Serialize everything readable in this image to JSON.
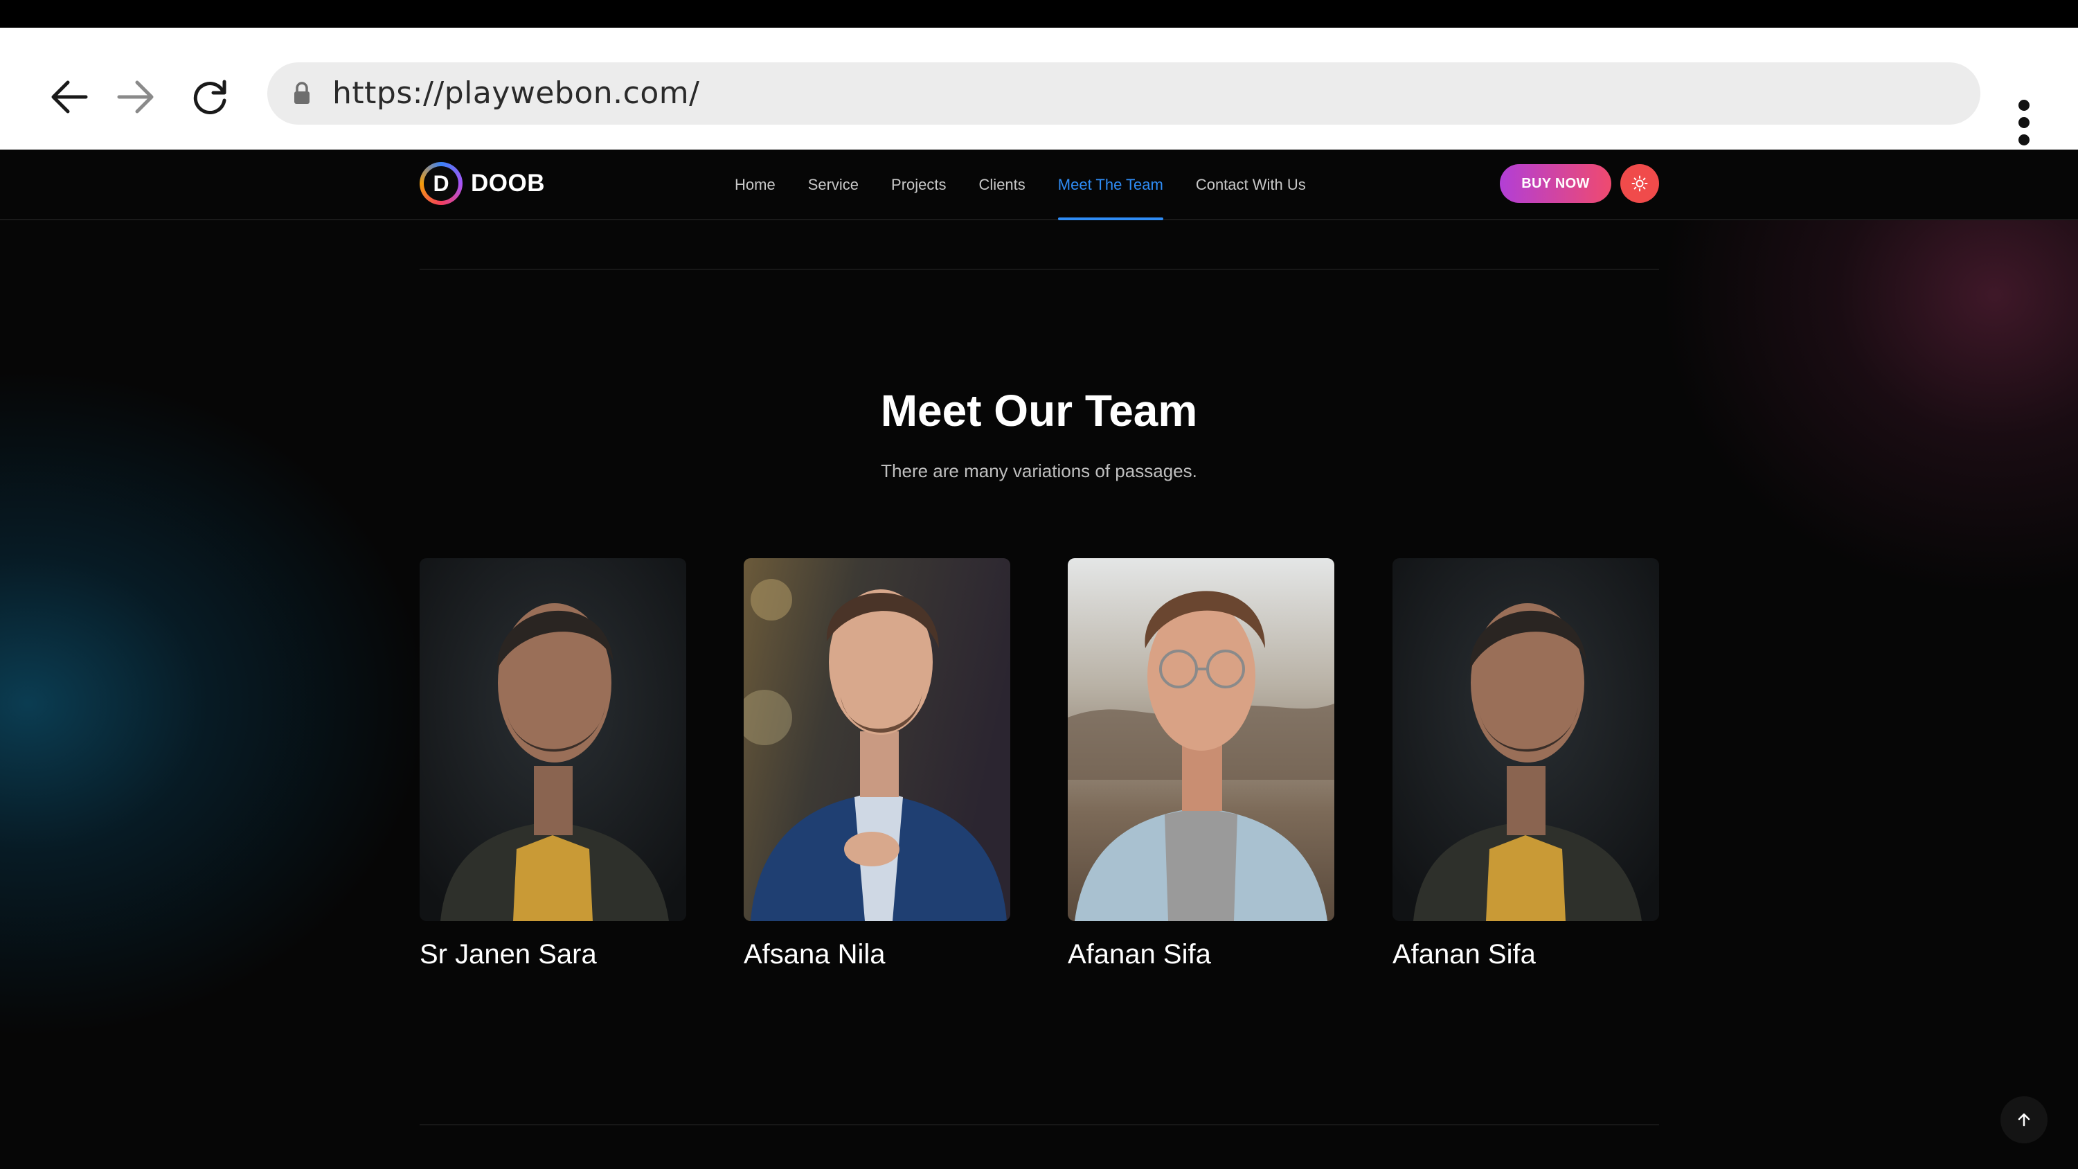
{
  "browser": {
    "url": "https://playwebon.com/",
    "back_icon": "arrow-left-icon",
    "forward_icon": "arrow-right-icon",
    "reload_icon": "reload-icon",
    "lock_icon": "lock-icon",
    "menu_icon": "more-vertical-icon"
  },
  "site": {
    "logo_letter": "D",
    "logo_text": "DOOB",
    "nav": [
      {
        "label": "Home",
        "active": false
      },
      {
        "label": "Service",
        "active": false
      },
      {
        "label": "Projects",
        "active": false
      },
      {
        "label": "Clients",
        "active": false
      },
      {
        "label": "Meet The Team",
        "active": true
      },
      {
        "label": "Contact With Us",
        "active": false
      }
    ],
    "buy_label": "BUY NOW",
    "theme_icon": "sun-icon",
    "accent_color": "#2f8cf5",
    "buy_gradient": [
      "#b23fd6",
      "#ef4a6f"
    ],
    "theme_button_color": "#f04b4b"
  },
  "team": {
    "title": "Meet Our Team",
    "subtitle": "There are many variations of passages.",
    "members": [
      {
        "name": "Sr Janen Sara"
      },
      {
        "name": "Afsana Nila"
      },
      {
        "name": "Afanan Sifa"
      },
      {
        "name": "Afanan Sifa"
      }
    ]
  },
  "scroll_top_icon": "arrow-up-icon"
}
